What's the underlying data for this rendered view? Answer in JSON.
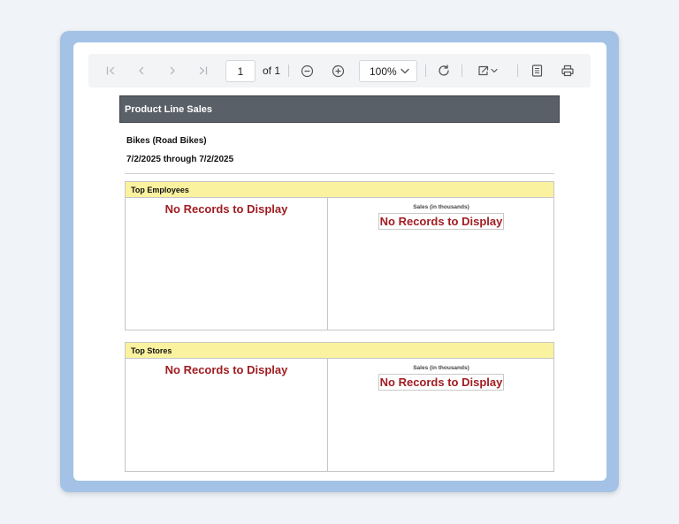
{
  "toolbar": {
    "first_page_icon": "first-page-icon",
    "prev_page_icon": "chevron-left-icon",
    "next_page_icon": "chevron-right-icon",
    "last_page_icon": "last-page-icon",
    "page_value": "1",
    "of_label": "of 1",
    "zoom_out_icon": "zoom-out-icon",
    "zoom_in_icon": "zoom-in-icon",
    "zoom_value": "100%",
    "refresh_icon": "refresh-icon",
    "export_icon": "export-icon",
    "parameters_icon": "document-icon",
    "print_icon": "print-icon"
  },
  "report": {
    "title": "Product Line Sales",
    "category": "Bikes (Road Bikes)",
    "date_range": "7/2/2025 through 7/2/2025",
    "sections": [
      {
        "heading": "Top Employees",
        "left_message": "No Records to Display",
        "chart_label": "Sales (in thousands)",
        "chart_message": "No Records to Display"
      },
      {
        "heading": "Top Stores",
        "left_message": "No Records to Display",
        "chart_label": "Sales (in thousands)",
        "chart_message": "No Records to Display"
      }
    ]
  },
  "colors": {
    "frame": "#a3c2e6",
    "banner": "#5a6068",
    "section_head": "#fbf29f",
    "no_records": "#a01d22"
  }
}
